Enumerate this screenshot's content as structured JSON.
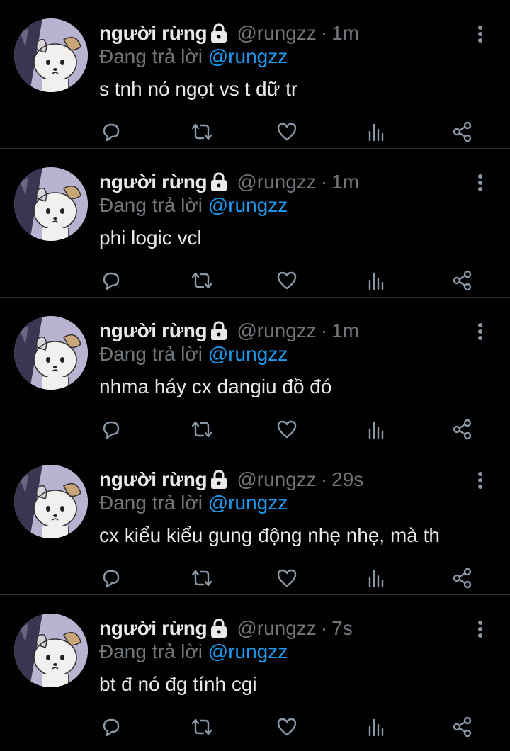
{
  "colors": {
    "background": "#000000",
    "text_primary": "#e7e9ea",
    "text_secondary": "#71767b",
    "mention": "#1d9bf0",
    "divider": "#2f3336",
    "icon": "#8b98a5"
  },
  "tweets": [
    {
      "name": "người rừng",
      "handle": "@rungzz",
      "separator": "·",
      "time": "1m",
      "reply_prefix": "Đang trả lời",
      "reply_to": "@rungzz",
      "text": "s tnh nó ngọt vs t dữ tr",
      "icons": [
        "lock-icon",
        "more-icon",
        "reply-icon",
        "retweet-icon",
        "like-icon",
        "stats-icon",
        "share-icon"
      ]
    },
    {
      "name": "người rừng",
      "handle": "@rungzz",
      "separator": "·",
      "time": "1m",
      "reply_prefix": "Đang trả lời",
      "reply_to": "@rungzz",
      "text": "phi logic vcl",
      "icons": [
        "lock-icon",
        "more-icon",
        "reply-icon",
        "retweet-icon",
        "like-icon",
        "stats-icon",
        "share-icon"
      ]
    },
    {
      "name": "người rừng",
      "handle": "@rungzz",
      "separator": "·",
      "time": "1m",
      "reply_prefix": "Đang trả lời",
      "reply_to": "@rungzz",
      "text": "nhma háy cx dangiu đồ đó",
      "icons": [
        "lock-icon",
        "more-icon",
        "reply-icon",
        "retweet-icon",
        "like-icon",
        "stats-icon",
        "share-icon"
      ]
    },
    {
      "name": "người rừng",
      "handle": "@rungzz",
      "separator": "·",
      "time": "29s",
      "reply_prefix": "Đang trả lời",
      "reply_to": "@rungzz",
      "text": "cx kiểu kiểu gung động nhẹ nhẹ, mà th",
      "icons": [
        "lock-icon",
        "more-icon",
        "reply-icon",
        "retweet-icon",
        "like-icon",
        "stats-icon",
        "share-icon"
      ]
    },
    {
      "name": "người rừng",
      "handle": "@rungzz",
      "separator": "·",
      "time": "7s",
      "reply_prefix": "Đang trả lời",
      "reply_to": "@rungzz",
      "text": "bt đ nó đg tính cgi",
      "icons": [
        "lock-icon",
        "more-icon",
        "reply-icon",
        "retweet-icon",
        "like-icon",
        "stats-icon",
        "share-icon"
      ]
    }
  ]
}
